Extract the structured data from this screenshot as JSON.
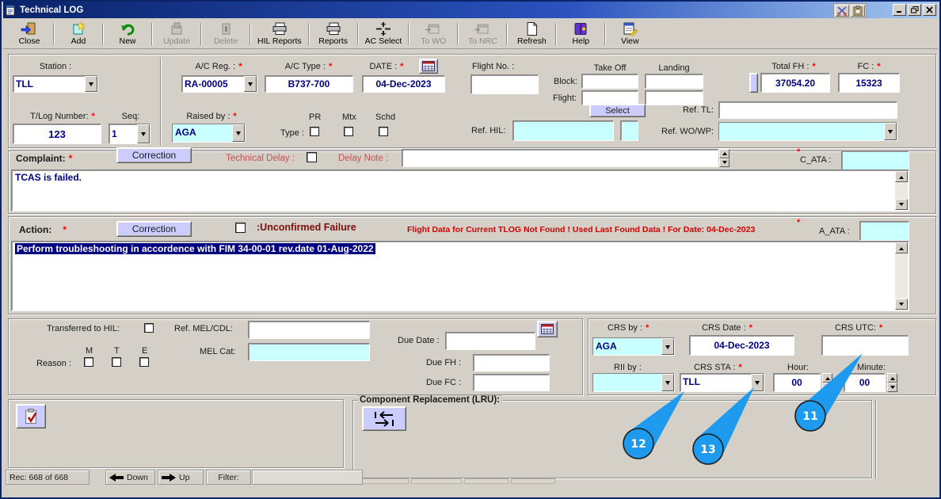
{
  "window": {
    "title": "Technical LOG"
  },
  "toolbar": {
    "items": [
      {
        "label": "Close",
        "enabled": true
      },
      {
        "label": "Add",
        "enabled": true
      },
      {
        "label": "New",
        "enabled": true
      },
      {
        "label": "Update",
        "enabled": false
      },
      {
        "label": "Delete",
        "enabled": false
      },
      {
        "label": "HIL Reports",
        "enabled": true
      },
      {
        "label": "Reports",
        "enabled": true
      },
      {
        "label": "AC Select",
        "enabled": true
      },
      {
        "label": "To WO",
        "enabled": false
      },
      {
        "label": "To NRC",
        "enabled": false
      },
      {
        "label": "Refresh",
        "enabled": true
      },
      {
        "label": "Help",
        "enabled": true
      },
      {
        "label": "View",
        "enabled": true
      }
    ]
  },
  "header": {
    "station_label": "Station :",
    "station_value": "TLL",
    "ac_reg_label": "A/C Reg. :",
    "ac_reg_value": "RA-00005",
    "ac_type_label": "A/C Type :",
    "ac_type_value": "B737-700",
    "date_label": "DATE :",
    "date_value": "04-Dec-2023",
    "flight_no_label": "Flight No. :",
    "block_label": "Block:",
    "flight_label": "Flight:",
    "takeoff_label": "Take Off",
    "landing_label": "Landing",
    "total_fh_label": "Total FH :",
    "total_fh_value": "37054.20",
    "fc_label": "FC :",
    "fc_value": "15323",
    "tlog_label": "T/Log Number:",
    "tlog_value": "123",
    "seq_label": "Seq:",
    "seq_value": "1",
    "raised_by_label": "Raised by :",
    "raised_by_value": "AGA",
    "type_label": "Type :",
    "pr_label": "PR",
    "mtx_label": "Mtx",
    "schd_label": "Schd",
    "ref_hil_label": "Ref. HIL:",
    "select_button": "Select",
    "ref_tl_label": "Ref. TL:",
    "ref_wowp_label": "Ref. WO/WP:"
  },
  "complaint": {
    "label": "Complaint:",
    "correction_button": "Correction",
    "technical_delay_label": "Technical Delay :",
    "delay_note_label": "Delay Note :",
    "c_ata_label": "C_ATA :",
    "text": "TCAS is failed."
  },
  "action": {
    "label": "Action:",
    "correction_button": "Correction",
    "unconfirmed_label": ":Unconfirmed Failure",
    "warning": "Flight Data for Current TLOG Not Found ! Used Last Found Data ! For Date: 04-Dec-2023",
    "a_ata_label": "A_ATA :",
    "text": "Perform troubleshooting in accordence with FIM 34-00-01 rev.date 01-Aug-2022"
  },
  "mel": {
    "transferred_label": "Transferred to HIL:",
    "ref_mel_label": "Ref. MEL/CDL:",
    "mel_cat_label": "MEL Cat:",
    "reason_label": "Reason :",
    "m_label": "M",
    "t_label": "T",
    "e_label": "E",
    "due_date_label": "Due Date :",
    "due_fh_label": "Due FH :",
    "due_fc_label": "Due FC :"
  },
  "crs": {
    "crs_by_label": "CRS by :",
    "crs_by_value": "AGA",
    "crs_date_label": "CRS Date :",
    "crs_date_value": "04-Dec-2023",
    "crs_utc_label": "CRS UTC:",
    "rii_by_label": "RII by :",
    "crs_sta_label": "CRS STA :",
    "crs_sta_value": "TLL",
    "hour_label": "Hour:",
    "hour_value": "00",
    "minute_label": "Minute:",
    "minute_value": "00"
  },
  "lru": {
    "label": "Component Replacement (LRU):"
  },
  "statusbar": {
    "rec": "Rec: 668 of 668",
    "down": "Down",
    "up": "Up",
    "filter_label": "Filter:"
  },
  "callouts": {
    "c11": "11",
    "c12": "12",
    "c13": "13"
  },
  "misc": {
    "required": "*"
  },
  "colors": {
    "callout_blue": "#1e9bee",
    "field_cyan": "#c9ffff",
    "button_lavender": "#ccccff",
    "value_navy": "#000080",
    "warning_red": "#d40000",
    "titlebar_navy": "#0a246a",
    "chrome_gray": "#d4d0c8"
  }
}
